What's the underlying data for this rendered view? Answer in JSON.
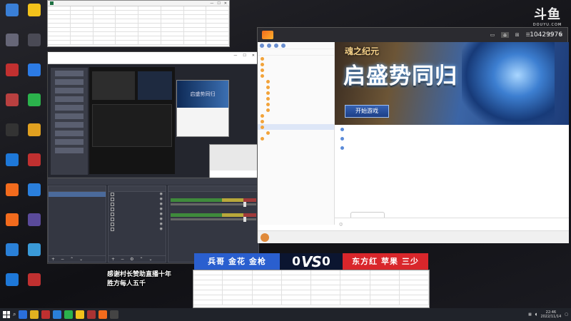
{
  "desktop": {
    "icons": [
      {
        "icon": "computer-icon",
        "label": "",
        "color": "#3a7fd6"
      },
      {
        "icon": "game-icon",
        "label": "",
        "color": "#f2c21b"
      },
      {
        "icon": "drive-icon",
        "label": "",
        "color": "#667"
      },
      {
        "icon": "app-icon",
        "label": "",
        "color": "#4a4a55"
      },
      {
        "icon": "app-icon",
        "label": "",
        "color": "#c13030"
      },
      {
        "icon": "flash-icon",
        "label": "",
        "color": "#2c7be5"
      },
      {
        "icon": "app-icon",
        "label": "",
        "color": "#b84040"
      },
      {
        "icon": "wechat-icon",
        "label": "",
        "color": "#2bb24c"
      },
      {
        "icon": "app-icon",
        "label": "",
        "color": "#333"
      },
      {
        "icon": "app-icon",
        "label": "",
        "color": "#e0a020"
      },
      {
        "icon": "qq-icon",
        "label": "",
        "color": "#1e78d8"
      },
      {
        "icon": "app-icon",
        "label": "",
        "color": "#c03030"
      },
      {
        "icon": "douyu-icon",
        "label": "",
        "color": "#f26b1d"
      },
      {
        "icon": "music-icon",
        "label": "",
        "color": "#2a7fdc"
      },
      {
        "icon": "douyu-icon",
        "label": "",
        "color": "#f26b1d"
      },
      {
        "icon": "app-icon",
        "label": "",
        "color": "#5a4a9a"
      },
      {
        "icon": "browser-icon",
        "label": "",
        "color": "#2a80d8"
      },
      {
        "icon": "browser-icon",
        "label": "",
        "color": "#3a9ad8"
      },
      {
        "icon": "qq-icon",
        "label": "",
        "color": "#1e78d8"
      },
      {
        "icon": "app-icon",
        "label": "",
        "color": "#c03030"
      }
    ]
  },
  "excel_top": {
    "title": "",
    "window_controls": [
      "—",
      "☐",
      "✕"
    ],
    "columns": [
      "",
      "",
      "",
      "",
      "",
      "",
      "",
      ""
    ]
  },
  "obs": {
    "title": "",
    "window_controls": [
      "—",
      "☐",
      "✕"
    ],
    "menu": [
      "",
      "",
      "",
      "",
      "",
      "",
      "",
      ""
    ],
    "mini_banner_text": "启盛势同归",
    "mini_card_caption": "",
    "scene_bar_left": "",
    "scene_bar_cfg": "",
    "docks": {
      "scenes": {
        "title": "",
        "items": [
          ""
        ]
      },
      "sources": {
        "title": "",
        "items": [
          "",
          "",
          "",
          "",
          "",
          "",
          "",
          ""
        ]
      },
      "mixer": {
        "title": "",
        "channels": [
          "",
          ""
        ]
      }
    }
  },
  "douyu": {
    "title": "",
    "id_label": "",
    "count_label": "",
    "title_icons": [
      "▭",
      "⌂",
      "⊞",
      "☰",
      "—",
      "☐",
      "✕"
    ],
    "mode_label": "",
    "tree": [
      {
        "label": "",
        "level": 0
      },
      {
        "label": "",
        "level": 0
      },
      {
        "label": "",
        "level": 0
      },
      {
        "label": "",
        "level": 0
      },
      {
        "label": "",
        "level": 1
      },
      {
        "label": "",
        "level": 1
      },
      {
        "label": "",
        "level": 1
      },
      {
        "label": "",
        "level": 1
      },
      {
        "label": "",
        "level": 1
      },
      {
        "label": "",
        "level": 1
      },
      {
        "label": "",
        "level": 0
      },
      {
        "label": "",
        "level": 0
      },
      {
        "label": "",
        "level": 0,
        "selected": true
      },
      {
        "label": "",
        "level": 1
      },
      {
        "label": "",
        "level": 0
      }
    ],
    "banner": {
      "game_name": "魂之纪元",
      "slogan": "启盛势同归",
      "play_button": "开始游戏"
    },
    "chat": {
      "pin": "",
      "messages": [
        "",
        "",
        ""
      ]
    },
    "bubble_text": "",
    "input_placeholder": "",
    "send_label": "",
    "bottom_left": [
      "",
      "",
      ""
    ],
    "bottom_right": [
      "",
      ""
    ]
  },
  "watermark": {
    "big": "斗鱼",
    "small": "DOUYU.COM"
  },
  "viewer_count": "10429976",
  "scoreboard": {
    "left_team": "兵哥 金花 金枪",
    "left_score": "0",
    "vs": "VS",
    "right_score": "0",
    "right_team": "东方红 苹果 三少",
    "left_color": "#2a5fcf",
    "right_color": "#d9262b"
  },
  "excel_bottom": {
    "columns": [
      "",
      "",
      "",
      "",
      "",
      "",
      "",
      ""
    ]
  },
  "caption": {
    "line1": "感谢村长赞助直播十年",
    "line2": "胜方每人五千"
  },
  "taskbar": {
    "apps": [
      "#2a6fdc",
      "#e0b020",
      "#c03030",
      "#2a80d8",
      "#2bb24c",
      "#f2c21b",
      "#aa3333",
      "#f26b1d",
      "#444"
    ],
    "tray_text": "",
    "clock_time": "22:46",
    "clock_date": "2022/11/14"
  }
}
